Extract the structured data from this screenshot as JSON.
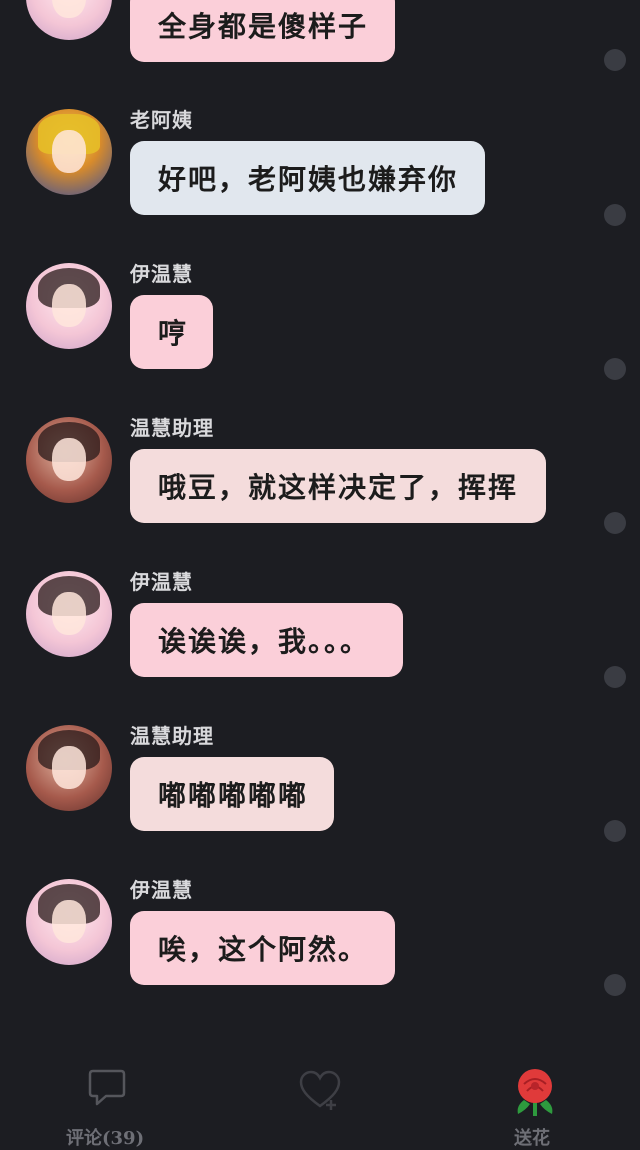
{
  "messages": [
    {
      "sender": "",
      "text": "全身都是傻样子",
      "bubble": "pink",
      "avatar": "pink"
    },
    {
      "sender": "老阿姨",
      "text": "好吧，老阿姨也嫌弃你",
      "bubble": "blue",
      "avatar": "gold"
    },
    {
      "sender": "伊温慧",
      "text": "哼",
      "bubble": "pink",
      "avatar": "pink"
    },
    {
      "sender": "温慧助理",
      "text": "哦豆，就这样决定了，挥挥",
      "bubble": "rose",
      "avatar": "rust"
    },
    {
      "sender": "伊温慧",
      "text": "诶诶诶，我。。。",
      "bubble": "pink",
      "avatar": "pink"
    },
    {
      "sender": "温慧助理",
      "text": "嘟嘟嘟嘟嘟",
      "bubble": "rose",
      "avatar": "rust"
    },
    {
      "sender": "伊温慧",
      "text": "唉，这个阿然。",
      "bubble": "pink",
      "avatar": "pink"
    }
  ],
  "tabbar": {
    "comments_label": "评论(39)",
    "like_icon": "heart-icon",
    "gift_label": "送花",
    "gift_icon": "rose-icon"
  },
  "colors": {
    "background": "#1c1d22",
    "bubble_pink": "#fbcfd9",
    "bubble_rose": "#f4dcdc",
    "bubble_blue": "#e1e7ee"
  }
}
